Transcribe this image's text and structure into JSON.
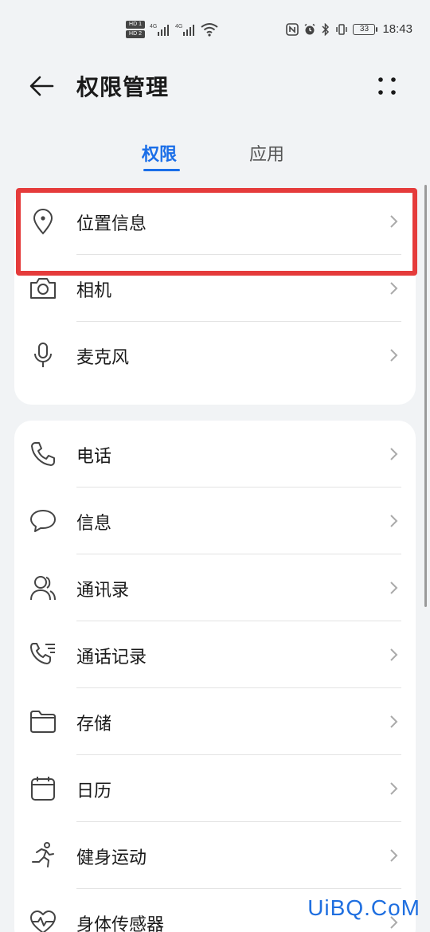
{
  "status_bar": {
    "time": "18:43",
    "battery": "33",
    "hd1": "HD 1",
    "hd2": "HD 2",
    "net1": "4G",
    "net2": "4G"
  },
  "header": {
    "title": "权限管理"
  },
  "tabs": [
    {
      "label": "权限",
      "active": true
    },
    {
      "label": "应用",
      "active": false
    }
  ],
  "group1": [
    {
      "label": "位置信息",
      "icon": "location-pin-icon"
    },
    {
      "label": "相机",
      "icon": "camera-icon"
    },
    {
      "label": "麦克风",
      "icon": "microphone-icon"
    }
  ],
  "group2": [
    {
      "label": "电话",
      "icon": "phone-icon"
    },
    {
      "label": "信息",
      "icon": "message-bubble-icon"
    },
    {
      "label": "通讯录",
      "icon": "contacts-icon"
    },
    {
      "label": "通话记录",
      "icon": "call-log-icon"
    },
    {
      "label": "存储",
      "icon": "folder-icon"
    },
    {
      "label": "日历",
      "icon": "calendar-icon"
    },
    {
      "label": "健身运动",
      "icon": "running-icon"
    },
    {
      "label": "身体传感器",
      "icon": "heart-rate-icon"
    }
  ],
  "watermark": "UiBQ.CoM",
  "colors": {
    "accent": "#1a6ee8",
    "highlight": "#e53b3b",
    "background": "#f1f3f5"
  }
}
